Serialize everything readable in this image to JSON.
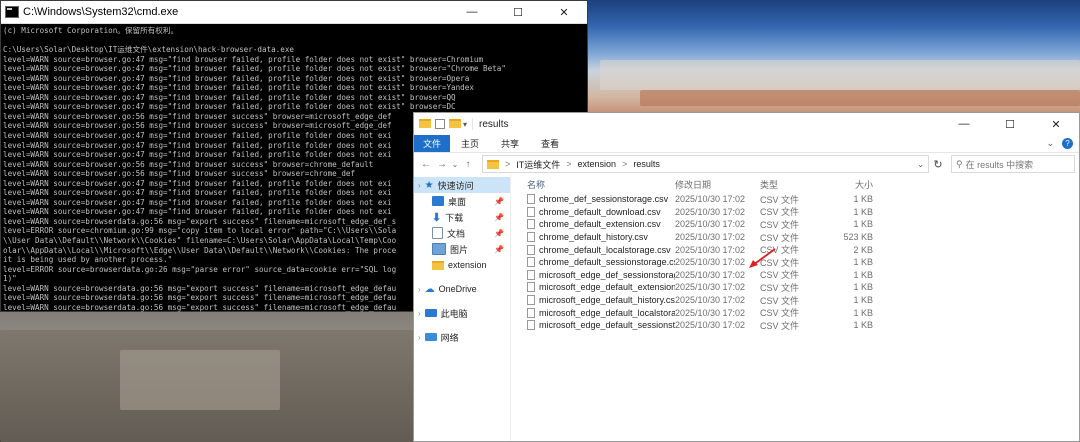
{
  "cmd": {
    "title": "C:\\Windows\\System32\\cmd.exe",
    "minimize": "—",
    "maximize": "☐",
    "close": "✕",
    "lines": [
      "(c) Microsoft Corporation。保留所有权利。",
      "",
      "C:\\Users\\Solar\\Desktop\\IT运维文件\\extension\\hack-browser-data.exe",
      "level=WARN source=browser.go:47 msg=\"find browser failed, profile folder does not exist\" browser=Chromium",
      "level=WARN source=browser.go:47 msg=\"find browser failed, profile folder does not exist\" browser=\"Chrome Beta\"",
      "level=WARN source=browser.go:47 msg=\"find browser failed, profile folder does not exist\" browser=Opera",
      "level=WARN source=browser.go:47 msg=\"find browser failed, profile folder does not exist\" browser=Yandex",
      "level=WARN source=browser.go:47 msg=\"find browser failed, profile folder does not exist\" browser=QQ",
      "level=WARN source=browser.go:47 msg=\"find browser failed, profile folder does not exist\" browser=DC",
      "level=WARN source=browser.go:56 msg=\"find browser success\" browser=microsoft_edge_def",
      "level=WARN source=browser.go:56 msg=\"find browser success\" browser=microsoft_edge_def",
      "level=WARN source=browser.go:47 msg=\"find browser failed, profile folder does not exi",
      "level=WARN source=browser.go:47 msg=\"find browser failed, profile folder does not exi",
      "level=WARN source=browser.go:47 msg=\"find browser failed, profile folder does not exi",
      "level=WARN source=browser.go:56 msg=\"find browser success\" browser=chrome_default",
      "level=WARN source=browser.go:56 msg=\"find browser success\" browser=chrome_def",
      "level=WARN source=browser.go:47 msg=\"find browser failed, profile folder does not exi",
      "level=WARN source=browser.go:47 msg=\"find browser failed, profile folder does not exi",
      "level=WARN source=browser.go:47 msg=\"find browser failed, profile folder does not exi",
      "level=WARN source=browser.go:47 msg=\"find browser failed, profile folder does not exi",
      "level=WARN source=browserdata.go:56 msg=\"export success\" filename=microsoft_edge_def_s",
      "level=ERROR source=chromium.go:99 msg=\"copy item to local error\" path=\"C:\\\\Users\\\\Sola",
      "\\\\User Data\\\\Default\\\\Network\\\\Cookies\" filename=C:\\Users\\Solar\\AppData\\Local\\Temp\\Coo",
      "olar\\\\AppData\\\\Local\\\\Microsoft\\\\Edge\\\\User Data\\\\Default\\\\Network\\\\Cookies: The proce",
      "it is being used by another process.\"",
      "level=ERROR source=browserdata.go:26 msg=\"parse error\" source_data=cookie err=\"SQL log",
      "1)\"",
      "level=WARN source=browserdata.go:56 msg=\"export success\" filename=microsoft_edge_defau",
      "level=WARN source=browserdata.go:56 msg=\"export success\" filename=microsoft_edge_defau",
      "level=WARN source=browserdata.go:56 msg=\"export success\" filename=microsoft_edge_defau"
    ]
  },
  "explorer": {
    "title": "results",
    "minimize": "—",
    "maximize": "☐",
    "close": "✕",
    "tabs": [
      "文件",
      "主页",
      "共享",
      "查看"
    ],
    "breadcrumb": [
      "IT运维文件",
      "extension",
      "results"
    ],
    "breadcrumb_sep": ">",
    "search_placeholder": "在 results 中搜索",
    "nav": {
      "quick_access": "快速访问",
      "items": [
        "桌面",
        "下载",
        "文档",
        "图片",
        "extension"
      ],
      "onedrive": "OneDrive",
      "this_pc": "此电脑",
      "network": "网络"
    },
    "columns": {
      "name": "名称",
      "date": "修改日期",
      "type": "类型",
      "size": "大小"
    },
    "files": [
      {
        "name": "chrome_def_sessionstorage.csv",
        "date": "2025/10/30 17:02",
        "type": "CSV 文件",
        "size": "1 KB"
      },
      {
        "name": "chrome_default_download.csv",
        "date": "2025/10/30 17:02",
        "type": "CSV 文件",
        "size": "1 KB"
      },
      {
        "name": "chrome_default_extension.csv",
        "date": "2025/10/30 17:02",
        "type": "CSV 文件",
        "size": "1 KB"
      },
      {
        "name": "chrome_default_history.csv",
        "date": "2025/10/30 17:02",
        "type": "CSV 文件",
        "size": "523 KB"
      },
      {
        "name": "chrome_default_localstorage.csv",
        "date": "2025/10/30 17:02",
        "type": "CSV 文件",
        "size": "2 KB"
      },
      {
        "name": "chrome_default_sessionstorage.csv",
        "date": "2025/10/30 17:02",
        "type": "CSV 文件",
        "size": "1 KB"
      },
      {
        "name": "microsoft_edge_def_sessionstorag...",
        "date": "2025/10/30 17:02",
        "type": "CSV 文件",
        "size": "1 KB"
      },
      {
        "name": "microsoft_edge_default_extension...",
        "date": "2025/10/30 17:02",
        "type": "CSV 文件",
        "size": "1 KB"
      },
      {
        "name": "microsoft_edge_default_history.csv",
        "date": "2025/10/30 17:02",
        "type": "CSV 文件",
        "size": "1 KB"
      },
      {
        "name": "microsoft_edge_default_localstora...",
        "date": "2025/10/30 17:02",
        "type": "CSV 文件",
        "size": "1 KB"
      },
      {
        "name": "microsoft_edge_default_sessionsto...",
        "date": "2025/10/30 17:02",
        "type": "CSV 文件",
        "size": "1 KB"
      }
    ]
  },
  "colors": {
    "file_tab": "#1e6fc7",
    "selection": "#cce4f7",
    "annotation_arrow": "#e02020"
  }
}
